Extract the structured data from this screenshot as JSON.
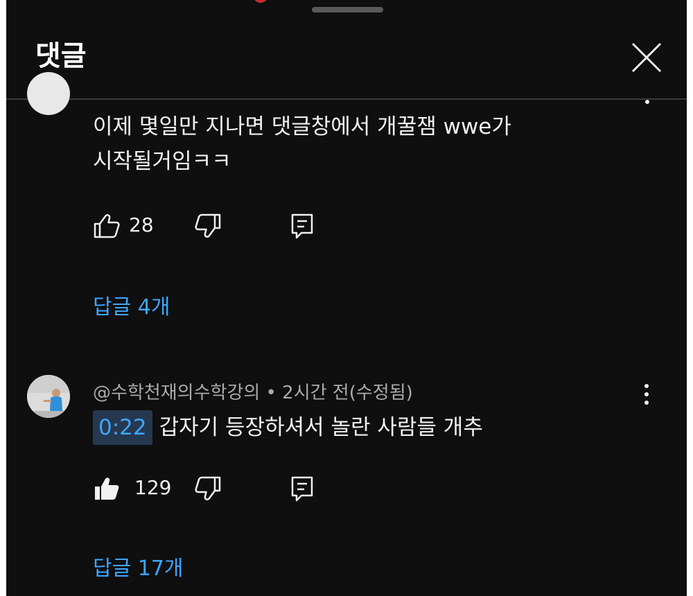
{
  "header": {
    "title": "댓글"
  },
  "comments": [
    {
      "text_line1": "이제 몇일만 지나면 댓글창에서 개꿀잼 wwe가",
      "text_line2": "시작될거임ㅋㅋ",
      "likes": "28",
      "liked": false,
      "replies_label": "답글 4개"
    },
    {
      "author": "@수학천재의수학강의",
      "separator": "•",
      "time": "2시간 전(수정됨)",
      "timestamp_link": "0:22",
      "text": "갑자기 등장하셔서 놀란 사람들 개추",
      "likes": "129",
      "liked": true,
      "replies_label": "답글 17개"
    }
  ],
  "icons": {
    "close": "close-icon",
    "like": "thumbs-up-icon",
    "dislike": "thumbs-down-icon",
    "reply": "reply-icon",
    "more": "more-vert-icon"
  },
  "colors": {
    "background": "#0f0f0f",
    "text": "#f1f1f1",
    "secondary_text": "#aaaaaa",
    "link": "#3ea6ff",
    "timestamp_bg": "#263850"
  }
}
